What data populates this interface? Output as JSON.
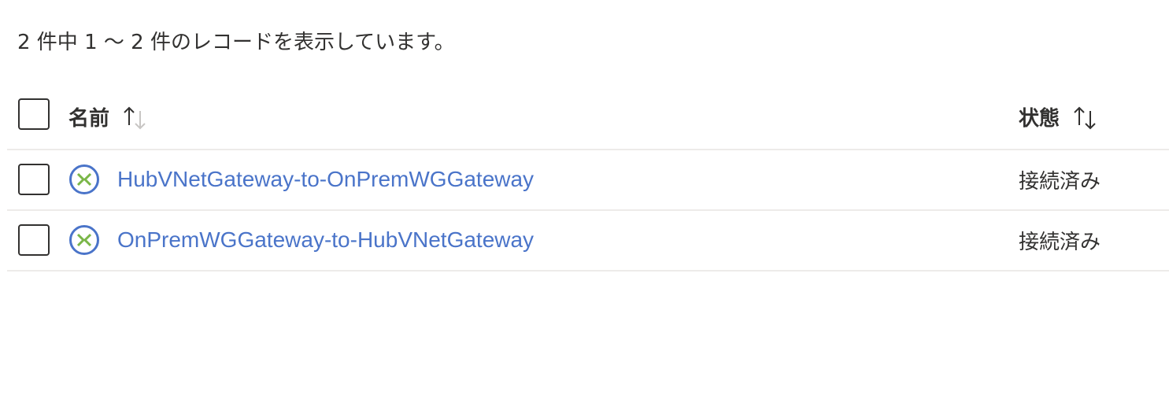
{
  "summary_text": "2 件中 1 ～ 2 件のレコードを表示しています。",
  "table": {
    "columns": [
      {
        "label": "名前",
        "sort": "ascending-active"
      },
      {
        "label": "状態",
        "sort": "both"
      }
    ],
    "rows": [
      {
        "name": "HubVNetGateway-to-OnPremWGGateway",
        "status": "接続済み",
        "icon": "connection-icon"
      },
      {
        "name": "OnPremWGGateway-to-HubVNetGateway",
        "status": "接続済み",
        "icon": "connection-icon"
      }
    ]
  },
  "colors": {
    "link": "#4a74c9",
    "text": "#323130",
    "divider": "#edebe9",
    "icon_ring": "#4a74c9",
    "icon_arrows": "#7ab648",
    "sort_inactive": "#c8c6c4"
  }
}
